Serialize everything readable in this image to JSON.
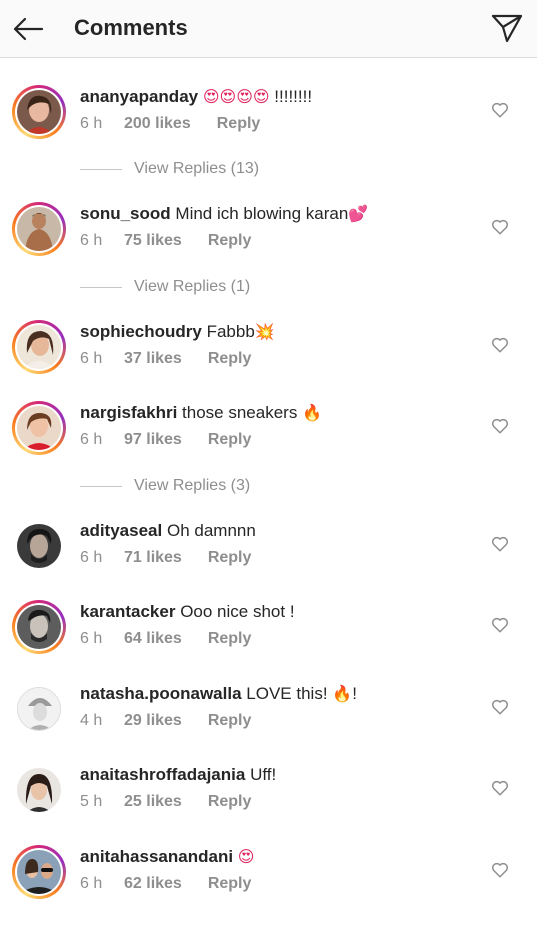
{
  "header": {
    "title": "Comments",
    "back_icon": "arrow-left-icon",
    "send_icon": "paper-plane-icon"
  },
  "comments": [
    {
      "username": "ananyapanday",
      "text": "",
      "emoji": "😍😍😍😍",
      "text_after": " !!!!!!!!",
      "time": "6 h",
      "likes": "200 likes",
      "reply": "Reply",
      "view_replies": "View Replies (13)",
      "ring": true
    },
    {
      "username": "sonu_sood",
      "text": "Mind ich blowing karan",
      "emoji": "💕",
      "text_after": "",
      "time": "6 h",
      "likes": "75 likes",
      "reply": "Reply",
      "view_replies": "View Replies (1)",
      "ring": true
    },
    {
      "username": "sophiechoudry",
      "text": "Fabbb",
      "emoji": "💥",
      "text_after": "",
      "time": "6 h",
      "likes": "37 likes",
      "reply": "Reply",
      "view_replies": "",
      "ring": true
    },
    {
      "username": "nargisfakhri",
      "text": "those sneakers ",
      "emoji": "🔥",
      "text_after": "",
      "time": "6 h",
      "likes": "97 likes",
      "reply": "Reply",
      "view_replies": "View Replies (3)",
      "ring": true
    },
    {
      "username": "adityaseal",
      "text": "Oh damnnn",
      "emoji": "",
      "text_after": "",
      "time": "6 h",
      "likes": "71 likes",
      "reply": "Reply",
      "view_replies": "",
      "ring": false
    },
    {
      "username": "karantacker",
      "text": "Ooo nice shot !",
      "emoji": "",
      "text_after": "",
      "time": "6 h",
      "likes": "64 likes",
      "reply": "Reply",
      "view_replies": "",
      "ring": true
    },
    {
      "username": "natasha.poonawalla",
      "text": "LOVE this! ",
      "emoji": "🔥",
      "text_after": "!",
      "time": "4 h",
      "likes": "29 likes",
      "reply": "Reply",
      "view_replies": "",
      "ring": false
    },
    {
      "username": "anaitashroffadajania",
      "text": "Uff!",
      "emoji": "",
      "text_after": "",
      "time": "5 h",
      "likes": "25 likes",
      "reply": "Reply",
      "view_replies": "",
      "ring": false
    },
    {
      "username": "anitahassanandani",
      "text": "",
      "emoji": "😍",
      "text_after": "",
      "time": "6 h",
      "likes": "62 likes",
      "reply": "Reply",
      "view_replies": "",
      "ring": true
    }
  ]
}
